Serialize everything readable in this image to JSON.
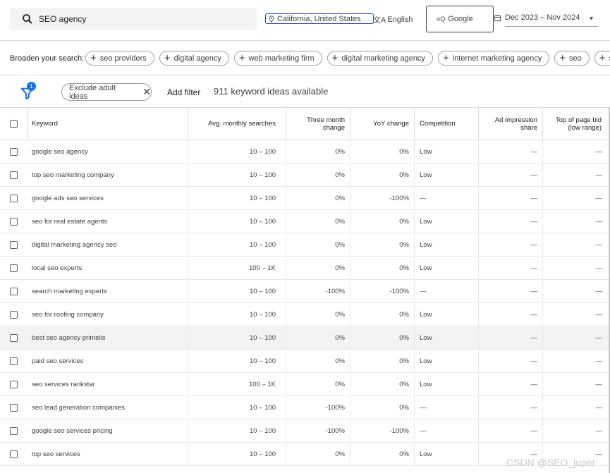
{
  "search": {
    "query": "SEO agency"
  },
  "location": "California, United States",
  "language": "English",
  "network": "Google",
  "date_range": "Dec 2023 – Nov 2024",
  "broaden": {
    "label": "Broaden your search:",
    "chips": [
      "seo providers",
      "digital agency",
      "web marketing firm",
      "digital marketing agency",
      "internet marketing agency",
      "seo",
      "seo"
    ]
  },
  "filter": {
    "badge": "1",
    "exclude_chip": "Exclude adult ideas",
    "add_filter": "Add filter",
    "count_text": "911 keyword ideas available"
  },
  "table": {
    "headers": {
      "keyword": "Keyword",
      "avg": "Avg. monthly searches",
      "three": "Three month change",
      "yoy": "YoY change",
      "comp": "Competition",
      "imp": "Ad impression share",
      "bid": "Top of page bid (low range)"
    },
    "rows": [
      {
        "keyword": "google seo agency",
        "avg": "10 – 100",
        "three": "0%",
        "yoy": "0%",
        "comp": "Low",
        "imp": "—",
        "bid": "—"
      },
      {
        "keyword": "top seo marketing company",
        "avg": "10 – 100",
        "three": "0%",
        "yoy": "0%",
        "comp": "Low",
        "imp": "—",
        "bid": "—"
      },
      {
        "keyword": "google ads seo services",
        "avg": "10 – 100",
        "three": "0%",
        "yoy": "-100%",
        "comp": "—",
        "imp": "—",
        "bid": "—"
      },
      {
        "keyword": "seo for real estate agents",
        "avg": "10 – 100",
        "three": "0%",
        "yoy": "0%",
        "comp": "Low",
        "imp": "—",
        "bid": "—"
      },
      {
        "keyword": "digital marketing agency seo",
        "avg": "10 – 100",
        "three": "0%",
        "yoy": "0%",
        "comp": "Low",
        "imp": "—",
        "bid": "—"
      },
      {
        "keyword": "local seo experts",
        "avg": "100 – 1K",
        "three": "0%",
        "yoy": "0%",
        "comp": "Low",
        "imp": "—",
        "bid": "—"
      },
      {
        "keyword": "search marketing experts",
        "avg": "10 – 100",
        "three": "-100%",
        "yoy": "-100%",
        "comp": "—",
        "imp": "—",
        "bid": "—"
      },
      {
        "keyword": "seo for roofing company",
        "avg": "10 – 100",
        "three": "0%",
        "yoy": "0%",
        "comp": "Low",
        "imp": "—",
        "bid": "—"
      },
      {
        "keyword": "best seo agency primelis",
        "avg": "10 – 100",
        "three": "0%",
        "yoy": "0%",
        "comp": "Low",
        "imp": "—",
        "bid": "—"
      },
      {
        "keyword": "paid seo services",
        "avg": "10 – 100",
        "three": "0%",
        "yoy": "0%",
        "comp": "Low",
        "imp": "—",
        "bid": "—"
      },
      {
        "keyword": "seo services rankstar",
        "avg": "100 – 1K",
        "three": "0%",
        "yoy": "0%",
        "comp": "Low",
        "imp": "—",
        "bid": "—"
      },
      {
        "keyword": "seo lead generation companies",
        "avg": "10 – 100",
        "three": "-100%",
        "yoy": "0%",
        "comp": "—",
        "imp": "—",
        "bid": "—"
      },
      {
        "keyword": "google seo services pricing",
        "avg": "10 – 100",
        "three": "-100%",
        "yoy": "-100%",
        "comp": "—",
        "imp": "—",
        "bid": "—"
      },
      {
        "keyword": "top seo services",
        "avg": "10 – 100",
        "three": "0%",
        "yoy": "0%",
        "comp": "Low",
        "imp": "—",
        "bid": "—"
      }
    ]
  },
  "watermark": "CSDN @SEO_juper"
}
